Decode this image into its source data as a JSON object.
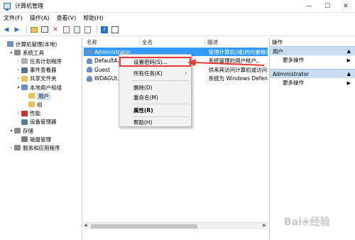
{
  "window": {
    "title": "计算机管理"
  },
  "menu": [
    "文件(F)",
    "操作(A)",
    "查看(V)",
    "帮助(H)"
  ],
  "tree": [
    {
      "label": "计算机管理(本地)",
      "depth": 0,
      "arrow": "",
      "color": "#6d8fb8"
    },
    {
      "label": "系统工具",
      "depth": 1,
      "arrow": "▾",
      "color": "#8c8c8c"
    },
    {
      "label": "任务计划程序",
      "depth": 2,
      "arrow": "›",
      "color": "#b0b0b0"
    },
    {
      "label": "事件查看器",
      "depth": 2,
      "arrow": "›",
      "color": "#5a6f8f"
    },
    {
      "label": "共享文件夹",
      "depth": 2,
      "arrow": "›",
      "color": "#e8c25a"
    },
    {
      "label": "本地用户和组",
      "depth": 2,
      "arrow": "▾",
      "color": "#6b8fc4"
    },
    {
      "label": "用户",
      "depth": 3,
      "arrow": "",
      "color": "#e8c25a",
      "selected": true
    },
    {
      "label": "组",
      "depth": 3,
      "arrow": "",
      "color": "#e8c25a"
    },
    {
      "label": "性能",
      "depth": 2,
      "arrow": "›",
      "color": "#c0392b"
    },
    {
      "label": "设备管理器",
      "depth": 2,
      "arrow": "",
      "color": "#607d8b"
    },
    {
      "label": "存储",
      "depth": 1,
      "arrow": "▾",
      "color": "#8c8c8c"
    },
    {
      "label": "磁盘管理",
      "depth": 2,
      "arrow": "",
      "color": "#7a7a7a"
    },
    {
      "label": "服务和应用程序",
      "depth": 1,
      "arrow": "›",
      "color": "#8c8c8c"
    }
  ],
  "list": {
    "columns": [
      "名称",
      "全名",
      "描述"
    ],
    "rows": [
      {
        "name": "Administrator",
        "full": "",
        "desc": "管理计算机(域)的内置帐户",
        "selected": true
      },
      {
        "name": "DefaultA...",
        "full": "",
        "desc": "系统管理的用户帐户。"
      },
      {
        "name": "Guest",
        "full": "",
        "desc": "供来宾访问计算机或访问域的内..."
      },
      {
        "name": "WDAGUt...",
        "full": "",
        "desc": "系统为 Windows Defender 应用..."
      }
    ]
  },
  "context_menu": {
    "items": [
      "设置密码(S)...",
      "所有任务(K)",
      "删除(D)",
      "重命名(M)",
      "属性(R)",
      "帮助(H)"
    ],
    "highlight_color": "#e53935"
  },
  "actions": {
    "title": "操作",
    "groups": [
      {
        "header": "用户",
        "item": "更多操作"
      },
      {
        "header": "Administrator",
        "item": "更多操作"
      }
    ]
  },
  "watermark": "Bai❀经验"
}
